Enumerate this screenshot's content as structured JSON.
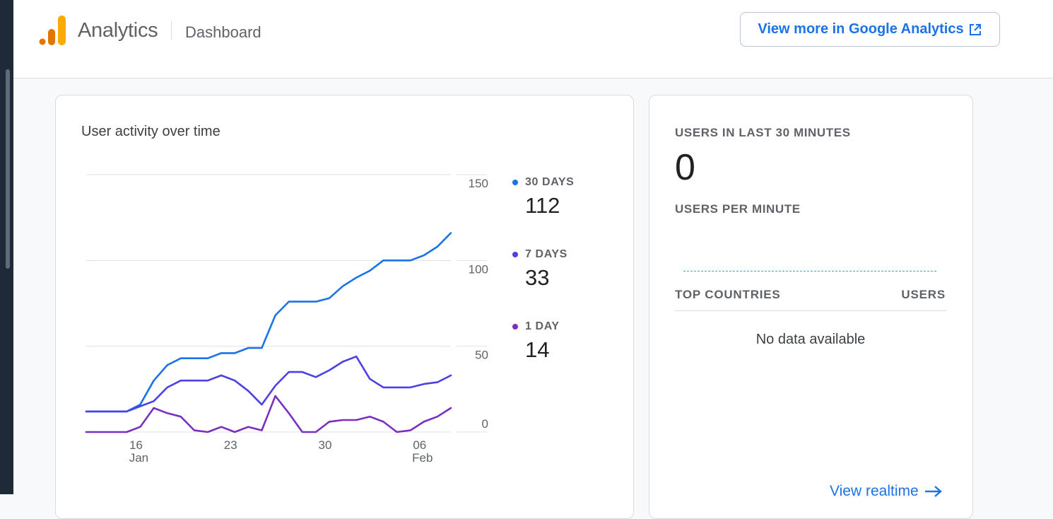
{
  "header": {
    "brand": "Analytics",
    "breadcrumb": "Dashboard",
    "ga_button_label": "View more in Google Analytics",
    "ga_button_icon": "external-link-icon",
    "logo_colors": [
      "#f9ab00",
      "#e37400"
    ]
  },
  "activity_card": {
    "title": "User activity over time",
    "legend": [
      {
        "label": "30 DAYS",
        "value": "112",
        "color": "#1a73e8"
      },
      {
        "label": "7 DAYS",
        "value": "33",
        "color": "#4c40e6"
      },
      {
        "label": "1 DAY",
        "value": "14",
        "color": "#7b2fbe"
      }
    ]
  },
  "chart_data": {
    "type": "line",
    "x": [
      "Jan 12",
      "Jan 13",
      "Jan 14",
      "Jan 15",
      "Jan 16",
      "Jan 17",
      "Jan 18",
      "Jan 19",
      "Jan 20",
      "Jan 21",
      "Jan 22",
      "Jan 23",
      "Jan 24",
      "Jan 25",
      "Jan 26",
      "Jan 27",
      "Jan 28",
      "Jan 29",
      "Jan 30",
      "Jan 31",
      "Feb 01",
      "Feb 02",
      "Feb 03",
      "Feb 04",
      "Feb 05",
      "Feb 06",
      "Feb 07",
      "Feb 08",
      "Feb 09"
    ],
    "x_ticks": [
      {
        "x": "Jan 16",
        "label": "16",
        "sublabel": "Jan"
      },
      {
        "x": "Jan 23",
        "label": "23",
        "sublabel": ""
      },
      {
        "x": "Jan 30",
        "label": "30",
        "sublabel": ""
      },
      {
        "x": "Feb 06",
        "label": "06",
        "sublabel": "Feb"
      }
    ],
    "y_ticks": [
      "150",
      "100",
      "50",
      "0"
    ],
    "ylim": [
      0,
      150
    ],
    "grid": true,
    "legend_position": "right",
    "series": [
      {
        "name": "30 DAYS",
        "color": "#1a73e8",
        "values": [
          12,
          12,
          12,
          12,
          16,
          30,
          39,
          43,
          43,
          43,
          46,
          46,
          49,
          49,
          68,
          76,
          76,
          76,
          78,
          85,
          90,
          94,
          100,
          100,
          100,
          103,
          108,
          116
        ]
      },
      {
        "name": "7 DAYS",
        "color": "#4c40e6",
        "values": [
          12,
          12,
          12,
          12,
          15,
          18,
          26,
          30,
          30,
          30,
          33,
          30,
          24,
          16,
          27,
          35,
          35,
          32,
          36,
          41,
          44,
          31,
          26,
          26,
          26,
          28,
          29,
          33
        ]
      },
      {
        "name": "1 DAY",
        "color": "#7b2fbe",
        "values": [
          0,
          0,
          0,
          0,
          3,
          14,
          11,
          9,
          1,
          0,
          3,
          0,
          3,
          1,
          21,
          11,
          0,
          0,
          6,
          7,
          7,
          9,
          6,
          0,
          1,
          6,
          9,
          14
        ]
      }
    ]
  },
  "realtime_card": {
    "users_label": "USERS IN LAST 30 MINUTES",
    "users_value": "0",
    "per_minute_label": "USERS PER MINUTE",
    "col_countries": "TOP COUNTRIES",
    "col_users": "USERS",
    "empty_text": "No data available",
    "link_label": "View realtime",
    "link_icon": "arrow-right-icon"
  }
}
